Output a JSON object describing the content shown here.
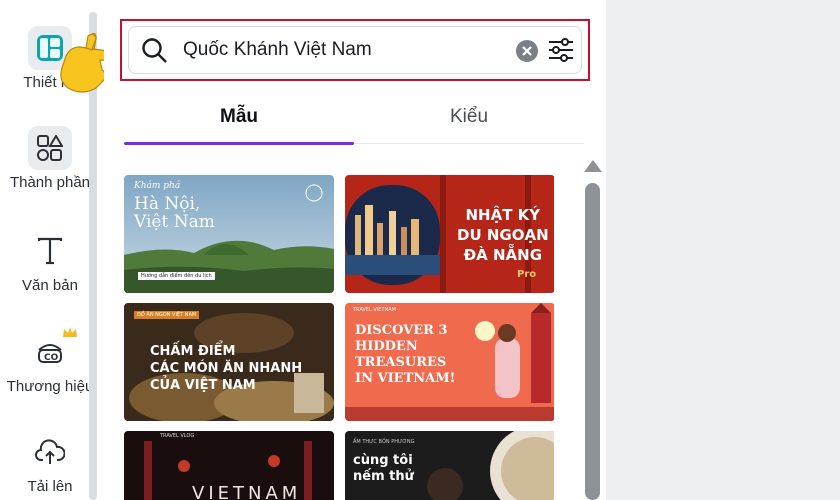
{
  "sidebar": {
    "items": [
      {
        "label": "Thiết kế",
        "icon": "design-icon"
      },
      {
        "label": "Thành phần",
        "icon": "elements-icon"
      },
      {
        "label": "Văn bản",
        "icon": "text-icon"
      },
      {
        "label": "Thương hiệu",
        "icon": "brand-icon"
      },
      {
        "label": "Tải lên",
        "icon": "upload-icon"
      }
    ]
  },
  "search": {
    "value": "Quốc Khánh Việt Nam",
    "placeholder": "Quốc Khánh Việt Nam"
  },
  "tabs": [
    {
      "label": "Mẫu",
      "active": true
    },
    {
      "label": "Kiểu",
      "active": false
    }
  ],
  "templates": [
    {
      "title": "Hà Nội,\nViệt Nam",
      "script": "Khám phá",
      "caption": "Hướng dẫn điểm đến du lịch"
    },
    {
      "title": "NHẬT KÝ\nDU NGOẠN\nĐÀ NẴNG",
      "badge": "Pro"
    },
    {
      "title": "CHẤM ĐIỂM\nCÁC MÓN ĂN NHANH\nCỦA VIỆT NAM",
      "caption": "ĐỒ ĂN NGON VIỆT NAM"
    },
    {
      "title": "DISCOVER 3\nHIDDEN\nTREASURES\nIN VIETNAM!",
      "caption": "TRAVEL VIETNAM"
    },
    {
      "title": "VIETNAM",
      "caption": "TRAVEL VLOG"
    },
    {
      "title": "cùng tôi\nnếm thử",
      "caption": "ẨM THỰC BỐN PHƯƠNG"
    }
  ],
  "colors": {
    "accent": "#7d2ae8",
    "highlight_border": "#c8102e",
    "design_tile": "#0ba5b1"
  }
}
